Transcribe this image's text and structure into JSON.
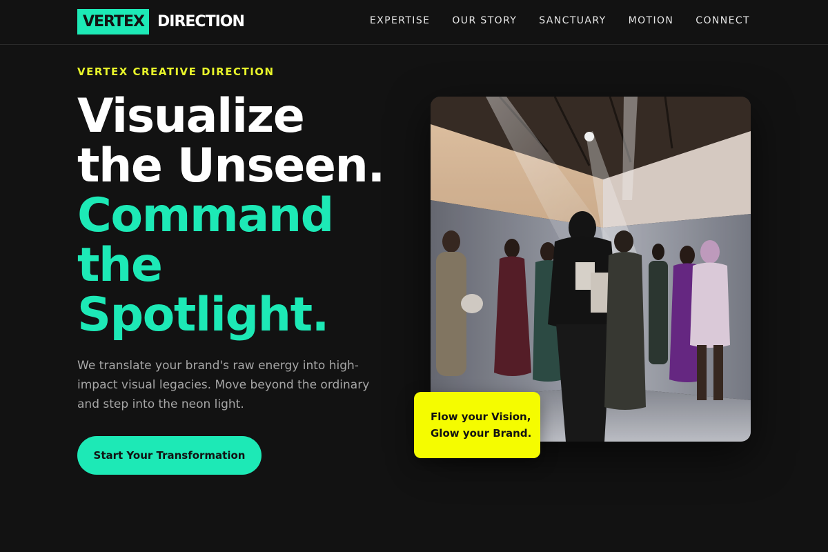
{
  "header": {
    "logo_box": "VERTEX",
    "logo_text": "DIRECTION",
    "nav": [
      "EXPERTISE",
      "OUR STORY",
      "SANCTUARY",
      "MOTION",
      "CONNECT"
    ]
  },
  "hero": {
    "eyebrow": "VERTEX CREATIVE DIRECTION",
    "headline_line1": "Visualize",
    "headline_line2": "the Unseen.",
    "headline_line3": "Command",
    "headline_line4": "the",
    "headline_line5": "Spotlight.",
    "subcopy": "We translate your brand's raw energy into high-impact visual legacies. Move beyond the ordinary and step into the neon light.",
    "cta_label": "Start Your Transformation",
    "badge_line1": "Flow your Vision,",
    "badge_line2": "Glow your Brand."
  },
  "colors": {
    "background": "#121212",
    "accent": "#1de9b6",
    "highlight": "#f5fc00",
    "eyebrow": "#e8f52a"
  }
}
